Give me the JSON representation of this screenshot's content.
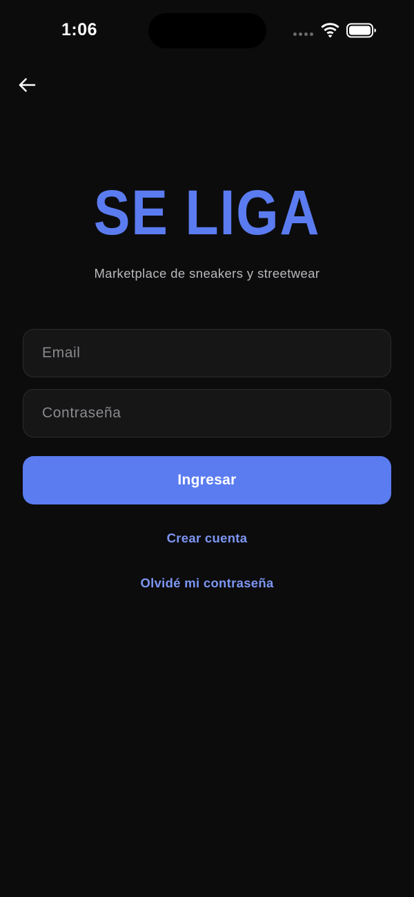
{
  "status_bar": {
    "time": "1:06"
  },
  "icons": {
    "back": "arrow-left-icon",
    "wifi": "wifi-icon",
    "battery": "battery-icon",
    "signal": "cellular-signal-icon"
  },
  "colors": {
    "accent": "#5b7cf0",
    "link": "#7d96f2",
    "background": "#0c0c0d",
    "input_background": "#161617"
  },
  "brand": {
    "title": "SE LIGA",
    "subtitle": "Marketplace de sneakers y streetwear"
  },
  "form": {
    "email_placeholder": "Email",
    "email_value": "",
    "password_placeholder": "Contraseña",
    "password_value": "",
    "submit_label": "Ingresar"
  },
  "links": {
    "create_account": "Crear cuenta",
    "forgot_password": "Olvidé mi contraseña"
  }
}
